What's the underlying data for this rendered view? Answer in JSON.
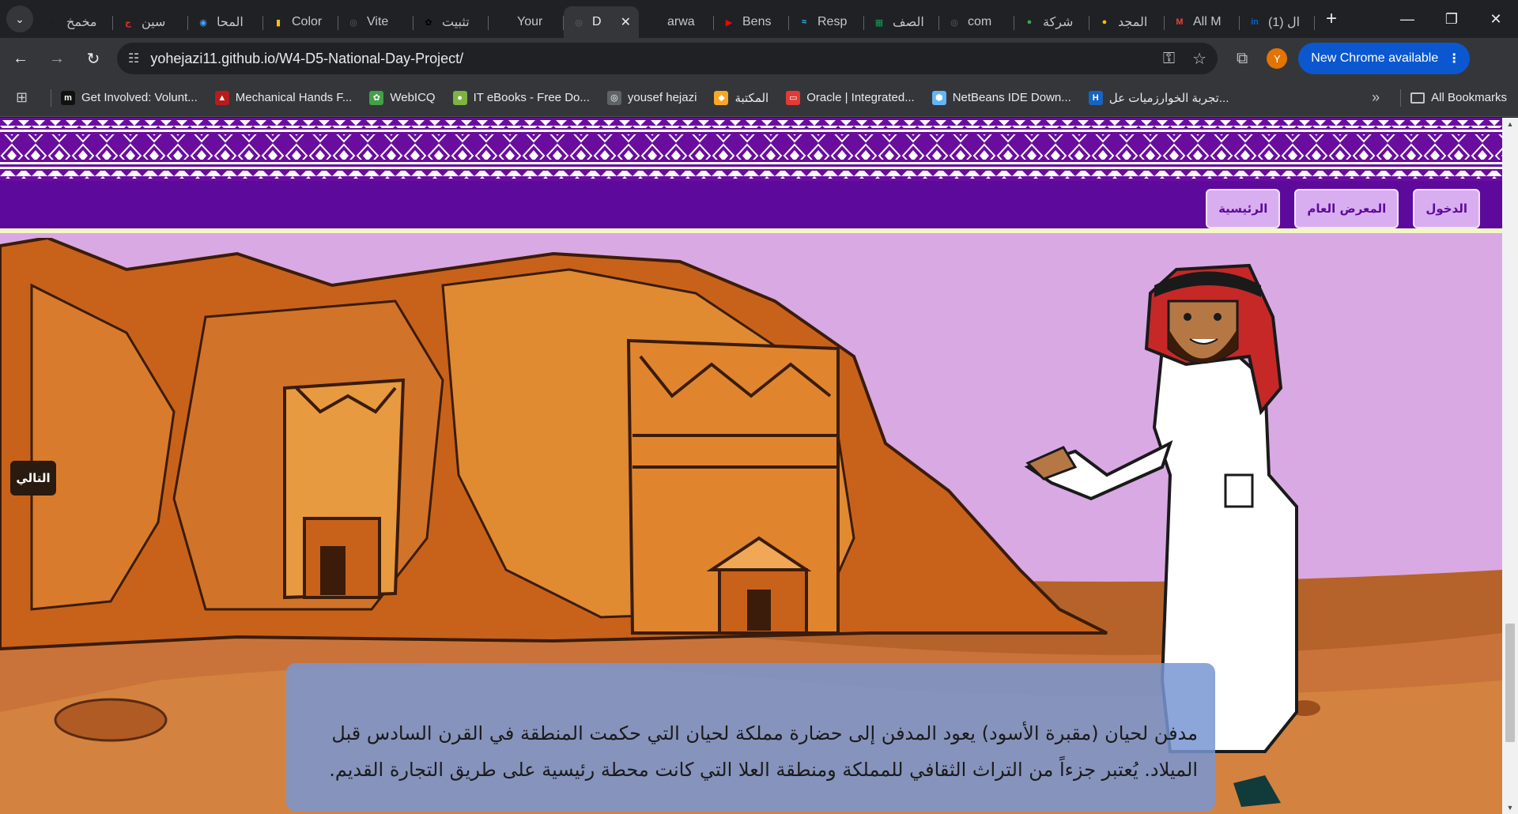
{
  "tabs": [
    {
      "title": "مخمخ",
      "fav": "-",
      "color": "#1a1a1a"
    },
    {
      "title": "سين",
      "fav": "ج",
      "color": "#d93025"
    },
    {
      "title": "المحا",
      "fav": "◉",
      "color": "#4aa3ff"
    },
    {
      "title": "Color",
      "fav": "▮",
      "color": "#f4c20d"
    },
    {
      "title": "Vite",
      "fav": "◎",
      "color": "#5f6368"
    },
    {
      "title": "تثبيت",
      "fav": "✿",
      "color": "#000000"
    },
    {
      "title": "Your",
      "fav": "◯",
      "color": "#202124"
    },
    {
      "title": "D",
      "fav": "◎",
      "color": "#5f6368",
      "active": true
    },
    {
      "title": "arwa",
      "fav": "◯",
      "color": "#202124"
    },
    {
      "title": "Bens",
      "fav": "▶",
      "color": "#ff0000"
    },
    {
      "title": "Resp",
      "fav": "≈",
      "color": "#38bdf8"
    },
    {
      "title": "الصف",
      "fav": "▦",
      "color": "#0f9d58"
    },
    {
      "title": "com",
      "fav": "◎",
      "color": "#5f6368"
    },
    {
      "title": "شركة",
      "fav": "●",
      "color": "#34a853"
    },
    {
      "title": "المجد",
      "fav": "●",
      "color": "#fbbc04"
    },
    {
      "title": "All M",
      "fav": "M",
      "color": "#ea4335"
    },
    {
      "title": "(1) ال",
      "fav": "in",
      "color": "#0a66c2"
    }
  ],
  "address": {
    "url": "yohejazi11.github.io/W4-D5-National-Day-Project/"
  },
  "update_label": "New Chrome available",
  "avatar_letter": "Y",
  "bookmarks": [
    {
      "label": "Get Involved: Volunt...",
      "icon": "m",
      "color": "#111111"
    },
    {
      "label": "Mechanical Hands F...",
      "icon": "▲",
      "color": "#b71c1c"
    },
    {
      "label": "WebICQ",
      "icon": "✿",
      "color": "#43a047"
    },
    {
      "label": "IT eBooks - Free Do...",
      "icon": "●",
      "color": "#7cb342"
    },
    {
      "label": "yousef hejazi",
      "icon": "◎",
      "color": "#5f6368"
    },
    {
      "label": "المكتبة",
      "icon": "◆",
      "color": "#f9a825"
    },
    {
      "label": "Oracle | Integrated...",
      "icon": "▭",
      "color": "#e53935"
    },
    {
      "label": "NetBeans IDE Down...",
      "icon": "⬢",
      "color": "#64b5f6"
    },
    {
      "label": "تجربة الخوارزميات عل...",
      "icon": "H",
      "color": "#1565c0"
    }
  ],
  "all_bookmarks_label": "All Bookmarks",
  "page": {
    "nav_buttons": {
      "login": "الدخول",
      "gallery": "المعرض العام",
      "home": "الرئيسية"
    },
    "next_button": "التالي",
    "caption": "مدفن لحيان (مقبرة الأسود) يعود المدفن إلى حضارة مملكة لحيان التي حكمت المنطقة في القرن السادس قبل الميلاد. يُعتبر جزءاً من التراث الثقافي للمملكة ومنطقة العلا التي كانت محطة رئيسية على طريق التجارة القديم."
  },
  "colors": {
    "accent_purple": "#5d0a9c",
    "button_bg": "#d9aef0",
    "sky": "#d9a9e4",
    "rock": "#c8621a"
  }
}
